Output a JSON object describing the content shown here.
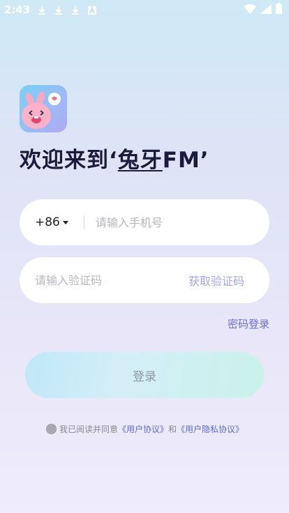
{
  "status_bar": {
    "time": "2:43"
  },
  "welcome": {
    "prefix": "欢迎来到‘",
    "brand": "兔牙",
    "suffix": "FM’"
  },
  "phone": {
    "country_code": "+86",
    "placeholder": "请输入手机号"
  },
  "verification": {
    "placeholder": "请输入验证码",
    "get_code_label": "获取验证码"
  },
  "password_login_label": "密码登录",
  "login_button_label": "登录",
  "agreement": {
    "prefix": "我已阅读并同意",
    "user_agreement": "《用户协议》",
    "and": "和",
    "privacy_agreement": "《用户隐私协议》"
  },
  "colors": {
    "accent": "#6a6fd8",
    "get_code": "#a2a6ea",
    "title": "#1d1b3d"
  }
}
